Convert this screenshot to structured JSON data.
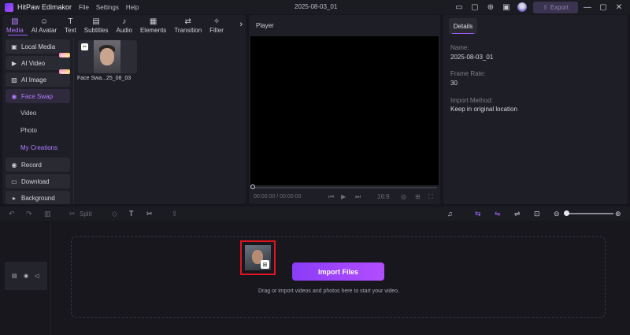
{
  "titlebar": {
    "app_name": "HitPaw Edimakor",
    "menu": [
      "File",
      "Settings",
      "Help"
    ],
    "project_title": "2025-08-03_01",
    "export_label": "Export"
  },
  "tabs": [
    {
      "label": "Media",
      "icon": "media-icon"
    },
    {
      "label": "AI Avatar",
      "icon": "avatar-icon"
    },
    {
      "label": "Text",
      "icon": "text-icon"
    },
    {
      "label": "Subtitles",
      "icon": "subtitles-icon"
    },
    {
      "label": "Audio",
      "icon": "audio-icon"
    },
    {
      "label": "Elements",
      "icon": "elements-icon"
    },
    {
      "label": "Transition",
      "icon": "transition-icon"
    },
    {
      "label": "Filter",
      "icon": "filter-icon"
    }
  ],
  "sidebar": {
    "local_media": "Local Media",
    "ai_video": "AI Video",
    "ai_image": "AI Image",
    "face_swap": "Face Swap",
    "sub_video": "Video",
    "sub_photo": "Photo",
    "sub_my_creations": "My Creations",
    "record": "Record",
    "download": "Download",
    "background": "Background",
    "new_badge": "NEW"
  },
  "media": {
    "item_label": "Face Swa...25_08_03"
  },
  "player": {
    "title": "Player",
    "timecode": "00:00:00 / 00:00:00",
    "ratio": "16:9"
  },
  "details": {
    "tab": "Details",
    "name_label": "Name:",
    "name_value": "2025-08-03_01",
    "frame_rate_label": "Frame Rate:",
    "frame_rate_value": "30",
    "import_method_label": "Import Method:",
    "import_method_value": "Keep in original location"
  },
  "timeline": {
    "split_label": "Split",
    "import_button": "Import Files",
    "drop_text": "Drag or import videos and photos here to start your video."
  },
  "colors": {
    "accent": "#9b5cff",
    "highlight_border": "#e0141f",
    "background": "#16161c"
  }
}
